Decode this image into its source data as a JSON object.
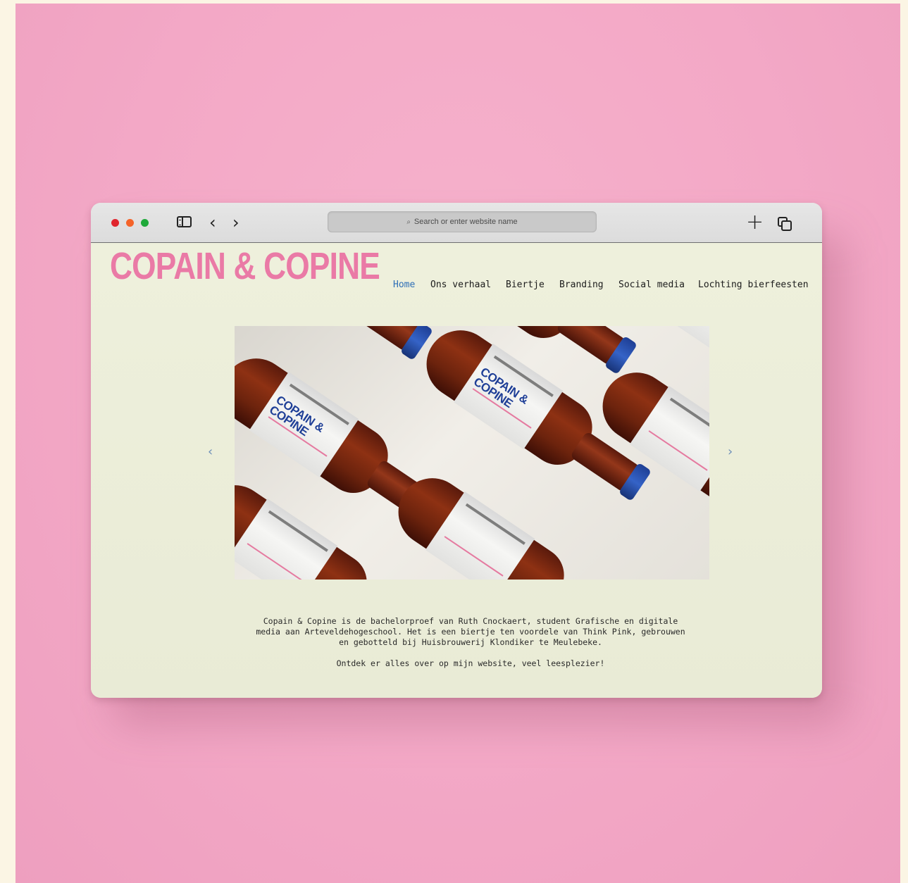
{
  "browser": {
    "search_placeholder": "Search or enter website name",
    "icons": [
      "sidebar-icon",
      "chevron-left-icon",
      "chevron-right-icon",
      "search-icon",
      "plus-icon",
      "tabs-icon"
    ]
  },
  "site": {
    "logo": "COPAIN & COPINE",
    "nav": [
      {
        "label": "Home",
        "active": true
      },
      {
        "label": "Ons verhaal",
        "active": false
      },
      {
        "label": "Biertje",
        "active": false
      },
      {
        "label": "Branding",
        "active": false
      },
      {
        "label": "Social media",
        "active": false
      },
      {
        "label": "Lochting bierfeesten",
        "active": false
      }
    ],
    "hero": {
      "bottle_label": "COPAIN & COPINE",
      "prev_arrow": "‹",
      "next_arrow": "›"
    },
    "about": {
      "paragraph1": "Copain & Copine is de bachelorproef van Ruth Cnockaert, student Grafische en digitale media aan Arteveldehogeschool. Het is een biertje ten voordele van Think Pink, gebrouwen en gebotteld bij Huisbrouwerij Klondiker te Meulebeke.",
      "paragraph2": "Ontdek er alles over op mijn website, veel leesplezier!"
    }
  },
  "colors": {
    "background_pink": "#f3a8c6",
    "logo_pink": "#ea7aa6",
    "nav_active_blue": "#2f6fb7",
    "page_background": "#eef0dc"
  }
}
